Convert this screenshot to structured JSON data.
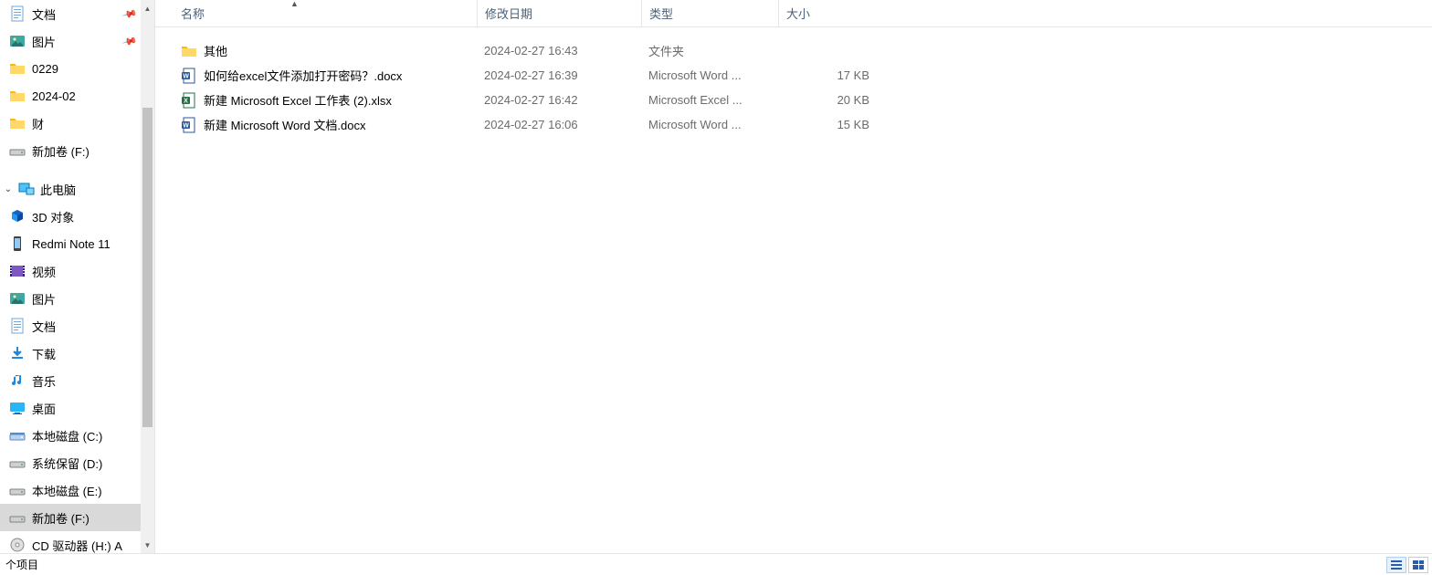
{
  "sidebar": {
    "quick": [
      {
        "icon": "doc",
        "label": "文档",
        "pinned": true
      },
      {
        "icon": "pic",
        "label": "图片",
        "pinned": true
      },
      {
        "icon": "folder",
        "label": "0229",
        "pinned": false
      },
      {
        "icon": "folder",
        "label": "2024-02",
        "pinned": false
      },
      {
        "icon": "folder",
        "label": "财",
        "pinned": false
      },
      {
        "icon": "drive",
        "label": "新加卷 (F:)",
        "pinned": false
      }
    ],
    "pc_label": "此电脑",
    "pc_items": [
      {
        "icon": "cube",
        "label": "3D 对象"
      },
      {
        "icon": "phone",
        "label": "Redmi Note 11"
      },
      {
        "icon": "video",
        "label": "视频"
      },
      {
        "icon": "pic",
        "label": "图片"
      },
      {
        "icon": "doc",
        "label": "文档"
      },
      {
        "icon": "download",
        "label": "下载"
      },
      {
        "icon": "music",
        "label": "音乐"
      },
      {
        "icon": "desktop",
        "label": "桌面"
      },
      {
        "icon": "hdd",
        "label": "本地磁盘 (C:)"
      },
      {
        "icon": "drive",
        "label": "系统保留 (D:)"
      },
      {
        "icon": "drive",
        "label": "本地磁盘 (E:)"
      },
      {
        "icon": "drive",
        "label": "新加卷 (F:)",
        "selected": true
      },
      {
        "icon": "cd",
        "label": "CD 驱动器 (H:) A"
      }
    ]
  },
  "columns": {
    "name": "名称",
    "date": "修改日期",
    "type": "类型",
    "size": "大小"
  },
  "files": [
    {
      "icon": "folder",
      "name": "其他",
      "date": "2024-02-27 16:43",
      "type": "文件夹",
      "size": ""
    },
    {
      "icon": "word",
      "name": "如何给excel文件添加打开密码？.docx",
      "date": "2024-02-27 16:39",
      "type": "Microsoft Word ...",
      "size": "17 KB"
    },
    {
      "icon": "excel",
      "name": "新建 Microsoft Excel 工作表 (2).xlsx",
      "date": "2024-02-27 16:42",
      "type": "Microsoft Excel ...",
      "size": "20 KB"
    },
    {
      "icon": "word",
      "name": "新建 Microsoft Word 文档.docx",
      "date": "2024-02-27 16:06",
      "type": "Microsoft Word ...",
      "size": "15 KB"
    }
  ],
  "status": {
    "text": "个项目"
  }
}
